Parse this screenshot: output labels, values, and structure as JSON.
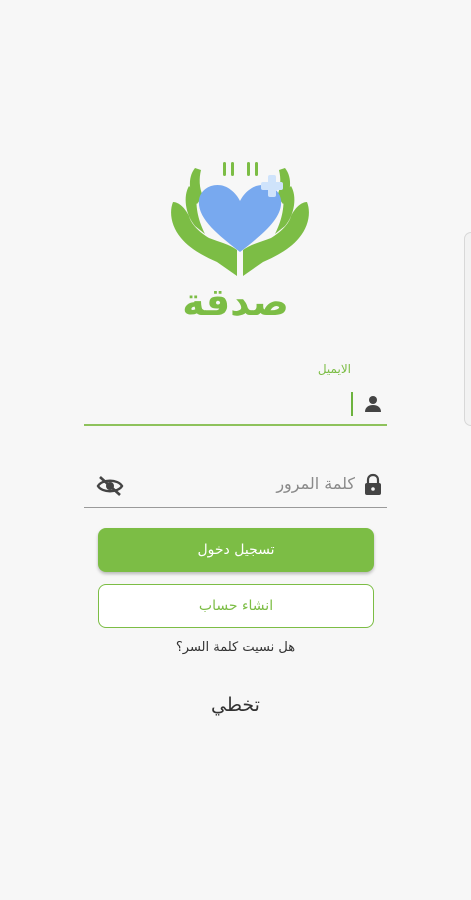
{
  "app": {
    "brand_name": "صدقة",
    "colors": {
      "accent": "#7cbd45",
      "heart": "#78a9ef",
      "background": "#f7f7f7"
    }
  },
  "form": {
    "email": {
      "label": "الايميل",
      "value": "",
      "icon": "person-icon"
    },
    "password": {
      "placeholder": "كلمة المرور",
      "value": "",
      "icon": "lock-icon",
      "toggle_icon": "eye-off-icon"
    },
    "login_button_label": "تسجيل دخول",
    "signup_button_label": "انشاء حساب",
    "forgot_password_link": "هل نسيت كلمة السر؟",
    "skip_link": "تخطي"
  }
}
